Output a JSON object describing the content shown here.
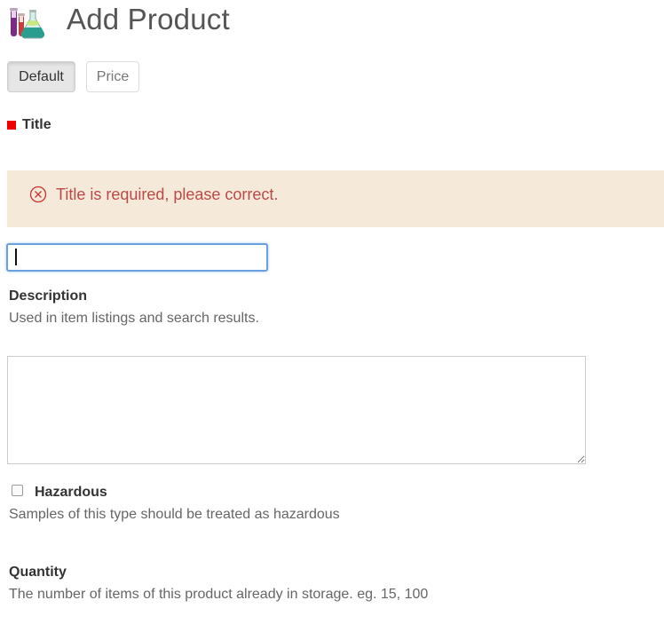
{
  "header": {
    "title": "Add Product",
    "icon": "lab-flasks-icon"
  },
  "tabs": [
    {
      "label": "Default",
      "active": true
    },
    {
      "label": "Price",
      "active": false
    }
  ],
  "form": {
    "title": {
      "label": "Title",
      "required": true,
      "error": "Title is required, please correct.",
      "value": "",
      "focused": true
    },
    "description": {
      "label": "Description",
      "help": "Used in item listings and search results.",
      "value": ""
    },
    "hazardous": {
      "label": "Hazardous",
      "help": "Samples of this type should be treated as hazardous",
      "checked": false
    },
    "quantity": {
      "label": "Quantity",
      "help": "The number of items of this product already in storage. eg. 15, 100"
    }
  },
  "colors": {
    "required_marker": "#ee0000",
    "error_bg": "#f5e9d9",
    "error_text": "#b94a48",
    "focus_border": "#6a9fe0"
  }
}
